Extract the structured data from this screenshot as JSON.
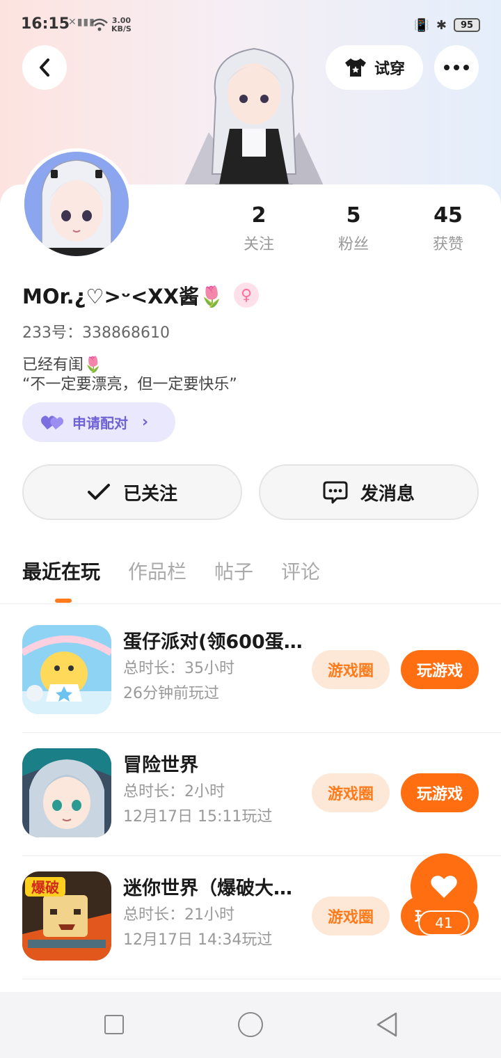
{
  "status_bar": {
    "time": "16:15",
    "net_speed_top": "3.00",
    "net_speed_bottom": "KB/S",
    "battery": "95"
  },
  "header": {
    "try_on_label": "试穿"
  },
  "stats": [
    {
      "value": "2",
      "label": "关注"
    },
    {
      "value": "5",
      "label": "粉丝"
    },
    {
      "value": "45",
      "label": "获赞"
    }
  ],
  "profile": {
    "name": "MOr.¿♡>ᵕ<XX酱🌷",
    "uid": "233号：338868610",
    "bio_line1": "已经有闺🌷",
    "bio_line2": "“不一定要漂亮，但一定要快乐”",
    "pair_label": "申请配对"
  },
  "actions": {
    "follow_label": "已关注",
    "message_label": "发消息"
  },
  "tabs": [
    "最近在玩",
    "作品栏",
    "帖子",
    "评论"
  ],
  "games": [
    {
      "title": "蛋仔派对(领600蛋…",
      "duration": "总时长：35小时",
      "last_played": "26分钟前玩过",
      "circle_label": "游戏圈",
      "play_label": "玩游戏"
    },
    {
      "title": "冒险世界",
      "duration": "总时长：2小时",
      "last_played": "12月17日 15:11玩过",
      "circle_label": "游戏圈",
      "play_label": "玩游戏"
    },
    {
      "title": "迷你世界（爆破大…",
      "duration": "总时长：21小时",
      "last_played": "12月17日 14:34玩过",
      "circle_label": "游戏圈",
      "play_label": "玩"
    }
  ],
  "like_fab": {
    "count": "41"
  },
  "icon_badge_text": "爆破",
  "colors": {
    "accent": "#ff6f12",
    "accent_soft": "#fde8d8",
    "pair_bg": "#e9e8fd",
    "pair_text": "#6e62d4"
  }
}
